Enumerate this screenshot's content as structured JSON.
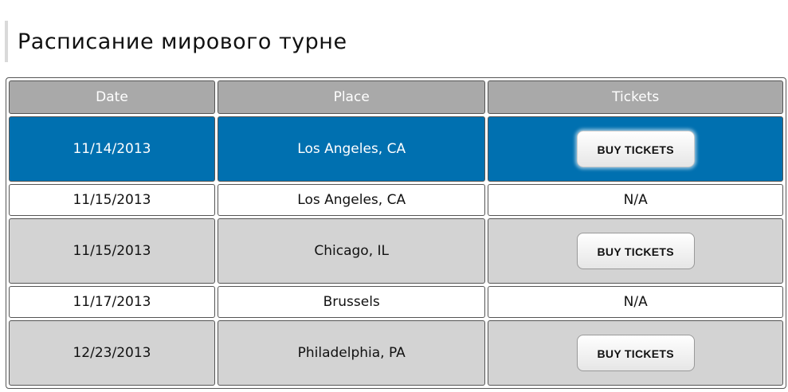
{
  "page": {
    "title": "Расписание мирового турне"
  },
  "table": {
    "headers": {
      "date": "Date",
      "place": "Place",
      "tickets": "Tickets"
    },
    "rows": [
      {
        "date": "11/14/2013",
        "place": "Los Angeles, CA",
        "tickets": "BUY TICKETS",
        "has_button": true,
        "state": "highlighted"
      },
      {
        "date": "11/15/2013",
        "place": "Los Angeles, CA",
        "tickets": "N/A",
        "has_button": false,
        "state": "white"
      },
      {
        "date": "11/15/2013",
        "place": "Chicago, IL",
        "tickets": "BUY TICKETS",
        "has_button": true,
        "state": "grey"
      },
      {
        "date": "11/17/2013",
        "place": "Brussels",
        "tickets": "N/A",
        "has_button": false,
        "state": "white"
      },
      {
        "date": "12/23/2013",
        "place": "Philadelphia, PA",
        "tickets": "BUY TICKETS",
        "has_button": true,
        "state": "grey"
      }
    ]
  },
  "colors": {
    "header_bg": "#a9a9a9",
    "highlight_bg": "#0070b0",
    "grey_row_bg": "#d3d3d3",
    "white_row_bg": "#ffffff"
  }
}
